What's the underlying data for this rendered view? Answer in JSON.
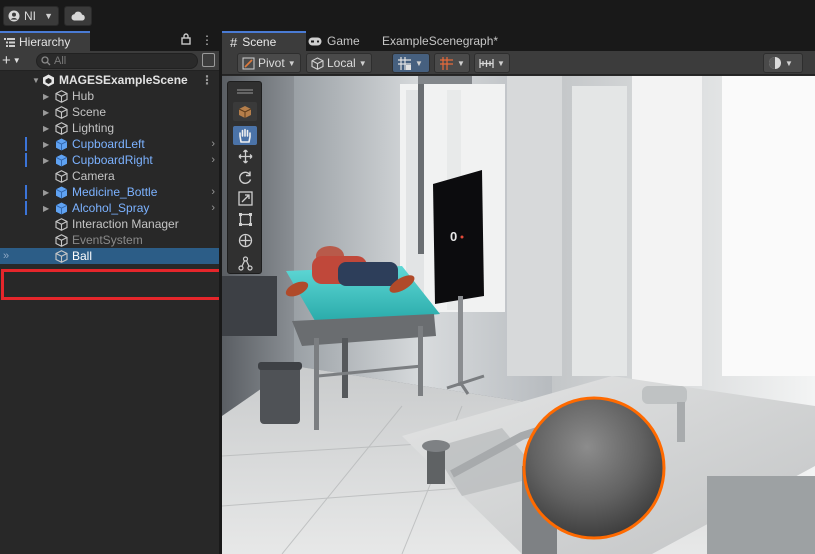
{
  "toolbar": {
    "account_initials": "NI"
  },
  "hierarchy": {
    "tab_label": "Hierarchy",
    "search_placeholder": "All",
    "scene_name": "MAGESExampleScene",
    "items": [
      {
        "label": "Hub",
        "expandable": true,
        "prefab": false,
        "submenu": false
      },
      {
        "label": "Scene",
        "expandable": true,
        "prefab": false,
        "submenu": false
      },
      {
        "label": "Lighting",
        "expandable": true,
        "prefab": false,
        "submenu": false
      },
      {
        "label": "CupboardLeft",
        "expandable": true,
        "prefab": true,
        "submenu": true
      },
      {
        "label": "CupboardRight",
        "expandable": true,
        "prefab": true,
        "submenu": true
      },
      {
        "label": "Camera",
        "expandable": false,
        "prefab": false,
        "submenu": false
      },
      {
        "label": "Medicine_Bottle",
        "expandable": true,
        "prefab": true,
        "submenu": true
      },
      {
        "label": "Alcohol_Spray",
        "expandable": true,
        "prefab": true,
        "submenu": true
      },
      {
        "label": "Interaction Manager",
        "expandable": false,
        "prefab": false,
        "submenu": false
      },
      {
        "label": "EventSystem",
        "expandable": false,
        "prefab": false,
        "submenu": false
      },
      {
        "label": "Ball",
        "expandable": false,
        "prefab": false,
        "submenu": false,
        "selected": true
      }
    ]
  },
  "scene_panel": {
    "tabs": [
      {
        "label": "Scene",
        "icon": "grid-icon"
      },
      {
        "label": "Game",
        "icon": "gamepad-icon"
      },
      {
        "label": "ExampleScenegraph*",
        "icon": ""
      }
    ],
    "pivot_label": "Pivot",
    "space_label": "Local",
    "tools": [
      "view-tool",
      "hand-tool",
      "move-tool",
      "rotate-tool",
      "scale-tool",
      "rect-tool",
      "transform-tool",
      "custom-tool"
    ],
    "active_tool": "hand-tool"
  },
  "colors": {
    "accent": "#4a7bd4",
    "prefab_text": "#7cb2ff",
    "selection": "#2c5d87",
    "highlight_box": "#e5262b",
    "ball_outline": "#ff6a00"
  }
}
